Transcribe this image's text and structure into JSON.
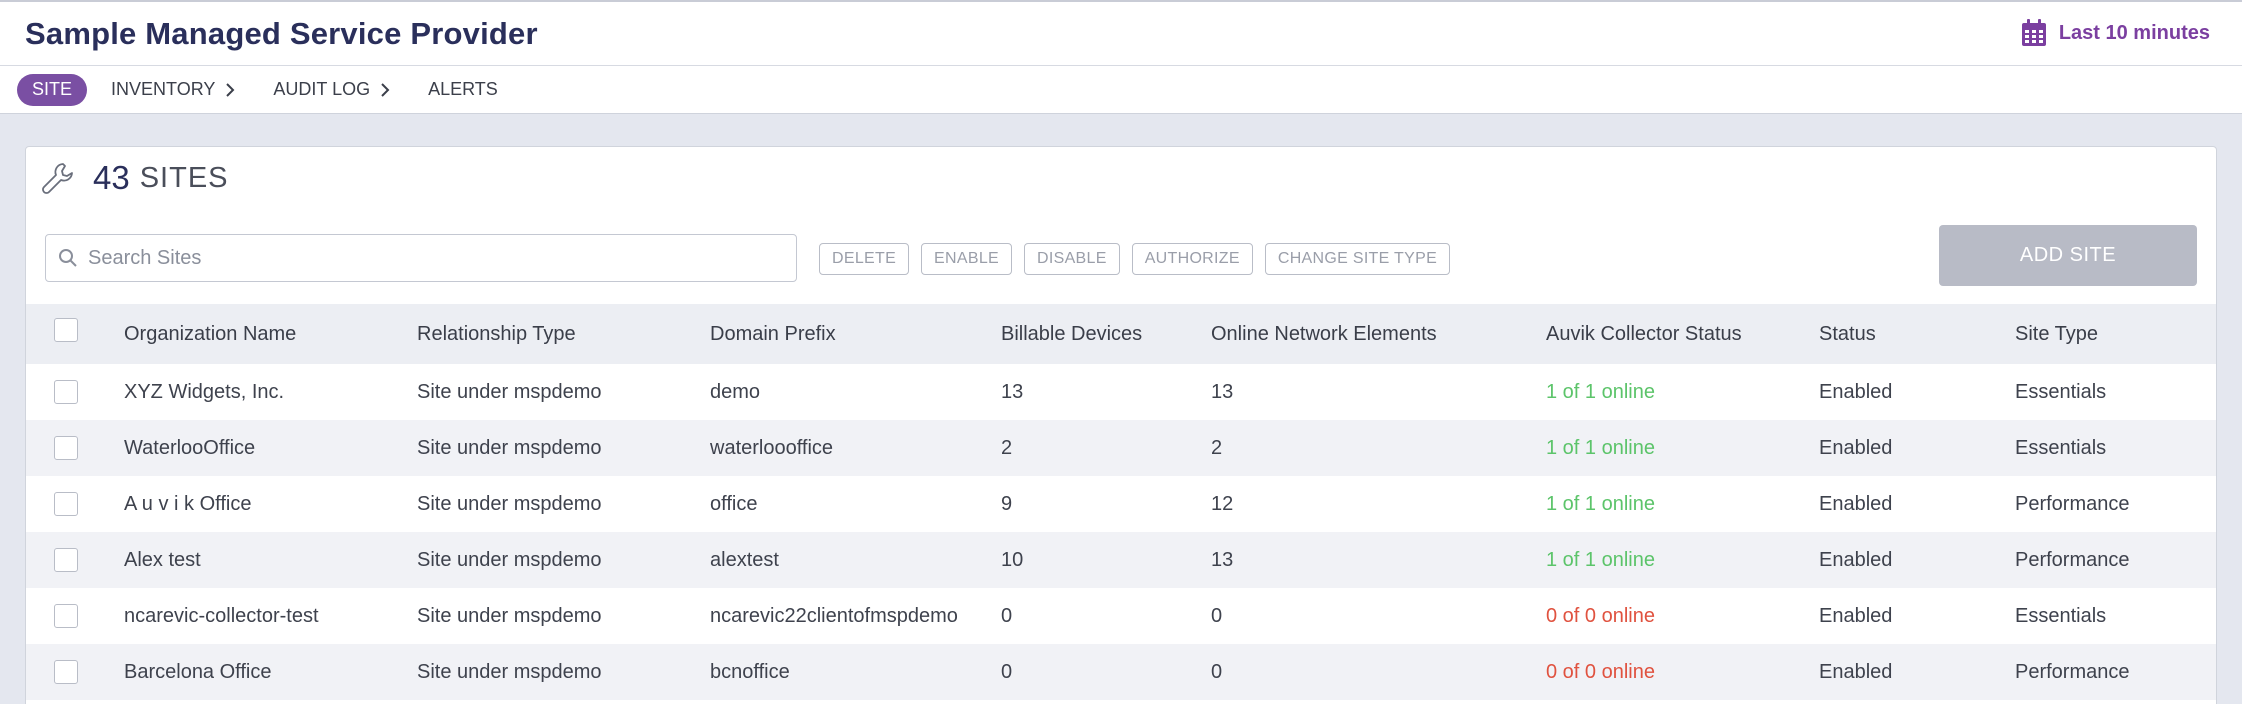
{
  "header": {
    "title": "Sample Managed Service Provider",
    "time_range": "Last 10 minutes",
    "calendar_icon": "calendar-icon"
  },
  "nav": {
    "items": [
      {
        "label": "SITE",
        "active": true,
        "chevron": false
      },
      {
        "label": "INVENTORY",
        "active": false,
        "chevron": true
      },
      {
        "label": "AUDIT LOG",
        "active": false,
        "chevron": true
      },
      {
        "label": "ALERTS",
        "active": false,
        "chevron": false
      }
    ]
  },
  "panel": {
    "count": "43",
    "count_label": "SITES",
    "icon": "wrench-icon",
    "search_placeholder": "Search Sites",
    "search_value": "",
    "actions": [
      "DELETE",
      "ENABLE",
      "DISABLE",
      "AUTHORIZE",
      "CHANGE SITE TYPE"
    ],
    "add_label": "ADD SITE"
  },
  "table": {
    "columns": [
      "Organization Name",
      "Relationship Type",
      "Domain Prefix",
      "Billable Devices",
      "Online Network Elements",
      "Auvik Collector Status",
      "Status",
      "Site Type"
    ],
    "rows": [
      {
        "org": "XYZ Widgets, Inc.",
        "rel": "Site under mspdemo",
        "domain": "demo",
        "billable": "13",
        "online": "13",
        "collector": "1 of 1 online",
        "collector_ok": true,
        "status": "Enabled",
        "type": "Essentials"
      },
      {
        "org": "WaterlooOffice",
        "rel": "Site under mspdemo",
        "domain": "waterloooffice",
        "billable": "2",
        "online": "2",
        "collector": "1 of 1 online",
        "collector_ok": true,
        "status": "Enabled",
        "type": "Essentials"
      },
      {
        "org": "A u v i k Office",
        "rel": "Site under mspdemo",
        "domain": "office",
        "billable": "9",
        "online": "12",
        "collector": "1 of 1 online",
        "collector_ok": true,
        "status": "Enabled",
        "type": "Performance"
      },
      {
        "org": "Alex test",
        "rel": "Site under mspdemo",
        "domain": "alextest",
        "billable": "10",
        "online": "13",
        "collector": "1 of 1 online",
        "collector_ok": true,
        "status": "Enabled",
        "type": "Performance"
      },
      {
        "org": "ncarevic-collector-test",
        "rel": "Site under mspdemo",
        "domain": "ncarevic22clientofmspdemo",
        "billable": "0",
        "online": "0",
        "collector": "0 of 0 online",
        "collector_ok": false,
        "status": "Enabled",
        "type": "Essentials"
      },
      {
        "org": "Barcelona Office",
        "rel": "Site under mspdemo",
        "domain": "bcnoffice",
        "billable": "0",
        "online": "0",
        "collector": "0 of 0 online",
        "collector_ok": false,
        "status": "Enabled",
        "type": "Performance"
      }
    ]
  },
  "colors": {
    "accent": "#7a4fa3",
    "title": "#2a2f5b",
    "online": "#5cc46a",
    "offline": "#e0523f"
  }
}
